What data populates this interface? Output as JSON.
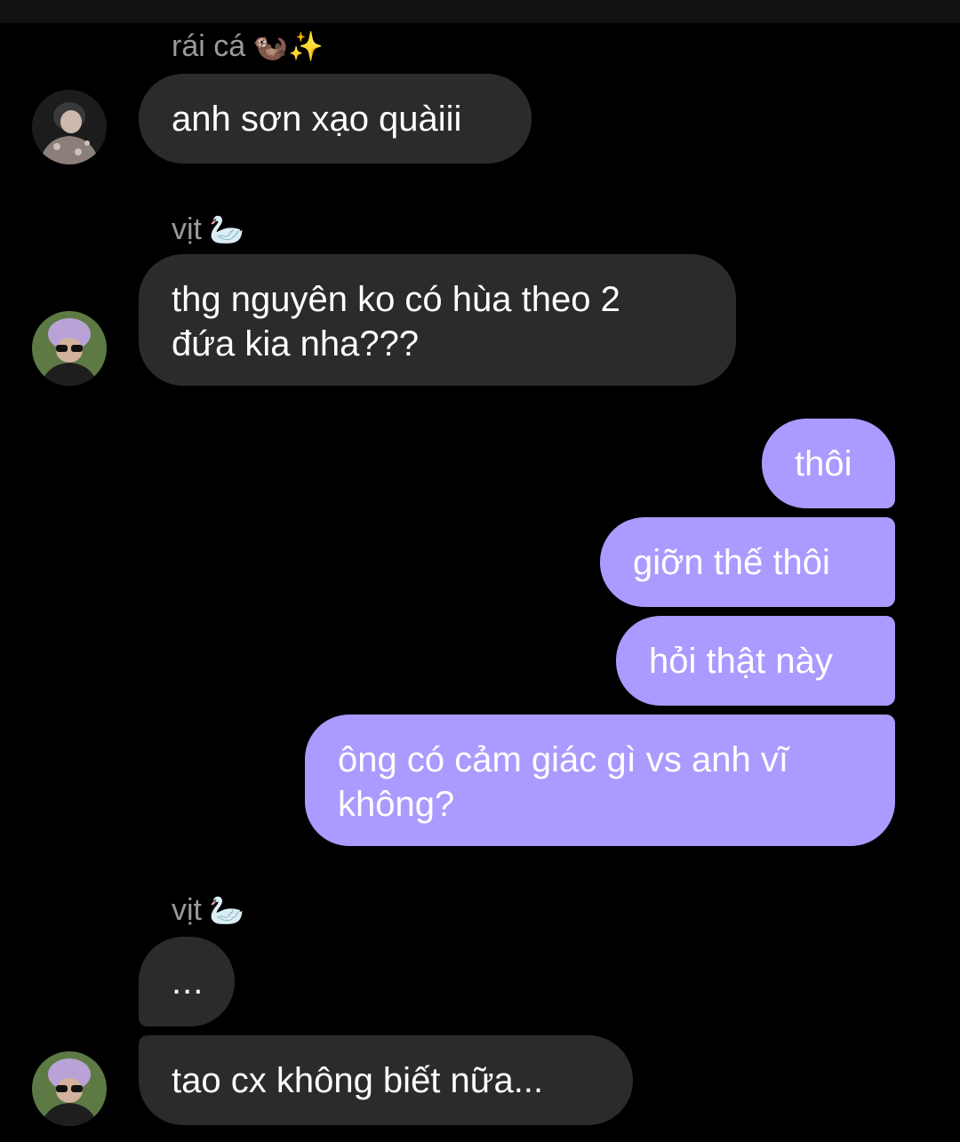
{
  "conversation": {
    "senders": {
      "raica": "rái cá",
      "raica_emoji": "🦦✨",
      "vit": "vịt",
      "vit_emoji": "🦢"
    },
    "messages": [
      {
        "from": "rái cá",
        "text": "anh sơn xạo quàiii"
      },
      {
        "from": "vịt",
        "line1": "thg nguyên ko có hùa theo 2",
        "line2": "đứa kia nha???"
      },
      {
        "from": "me",
        "text": "thôi"
      },
      {
        "from": "me",
        "text": "giỡn thế thôi"
      },
      {
        "from": "me",
        "text": "hỏi thật này"
      },
      {
        "from": "me",
        "line1": "ông có cảm giác gì vs anh vĩ",
        "line2": "không?"
      },
      {
        "from": "vịt",
        "text": "..."
      },
      {
        "from": "vịt",
        "text": "tao cx không biết nữa..."
      }
    ]
  },
  "colors": {
    "background": "#000000",
    "incoming_bubble": "#2b2b2b",
    "outgoing_bubble": "#a99bff",
    "sender_name": "#9a9a9a"
  }
}
